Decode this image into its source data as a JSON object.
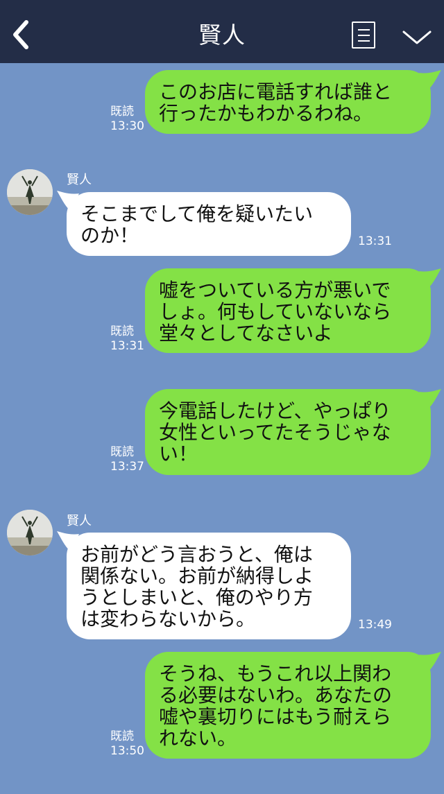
{
  "header": {
    "title": "賢人"
  },
  "messages": [
    {
      "sender": "me",
      "text": "このお店に電話すれば誰と\n行ったかもわかるわね。",
      "read": "既読",
      "time": "13:30"
    },
    {
      "sender": "them",
      "name": "賢人",
      "text": "そこまでして俺を疑いたい\nのか！",
      "time": "13:31"
    },
    {
      "sender": "me",
      "text": "嘘をついている方が悪いで\nしょ。何もしていないなら\n堂々としてなさいよ",
      "read": "既読",
      "time": "13:31"
    },
    {
      "sender": "me",
      "text": "今電話したけど、やっぱり\n女性といってたそうじゃな\nい！",
      "read": "既読",
      "time": "13:37"
    },
    {
      "sender": "them",
      "name": "賢人",
      "text": "お前がどう言おうと、俺は\n関係ない。お前が納得しよ\nうとしまいと、俺のやり方\nは変わらないから。",
      "time": "13:49"
    },
    {
      "sender": "me",
      "text": "そうね、もうこれ以上関わ\nる必要はないわ。あなたの\n嘘や裏切りにはもう耐えら\nれない。",
      "read": "既読",
      "time": "13:50"
    }
  ]
}
